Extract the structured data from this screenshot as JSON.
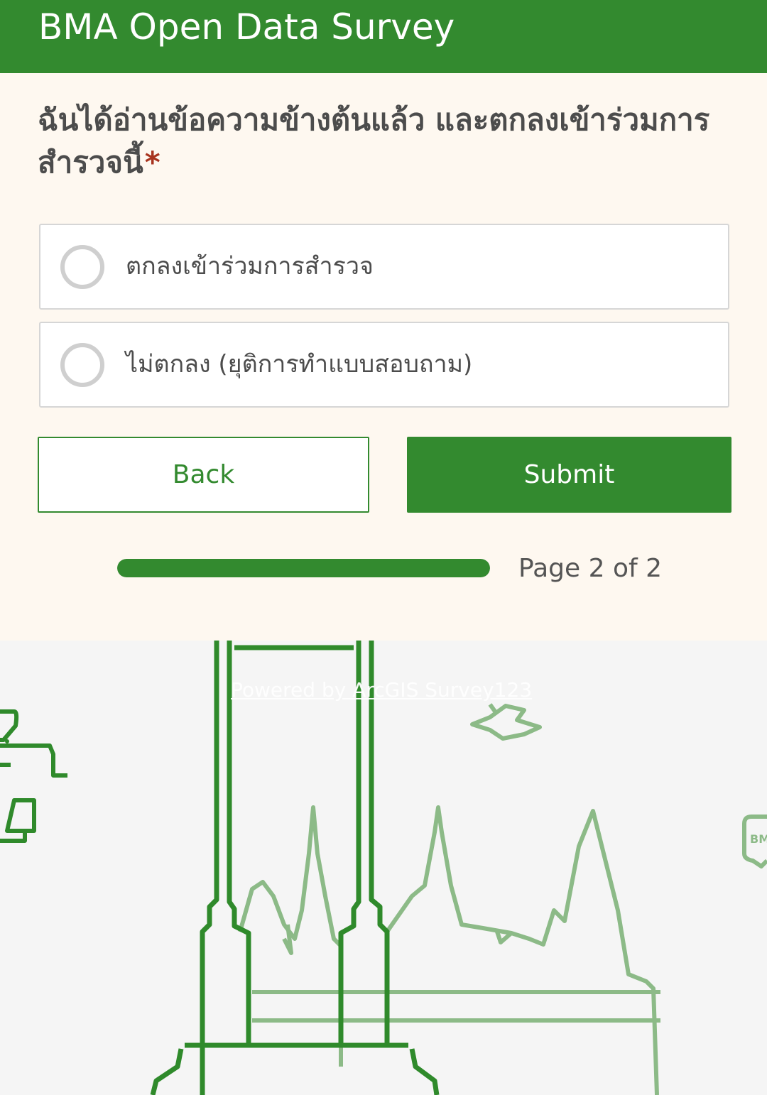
{
  "header": {
    "title": "BMA Open Data Survey"
  },
  "question": {
    "text": "ฉันได้อ่านข้อความข้างต้นแล้ว และตกลงเข้าร่วมการสำรวจนี้",
    "required_marker": "*"
  },
  "choices": [
    {
      "label": "ตกลงเข้าร่วมการสำรวจ",
      "selected": false
    },
    {
      "label": "ไม่ตกลง (ยุติการทำแบบสอบถาม)",
      "selected": false
    }
  ],
  "buttons": {
    "back_label": "Back",
    "submit_label": "Submit"
  },
  "progress": {
    "label": "Page 2 of 2",
    "fraction": 1.0
  },
  "footer": {
    "powered_by": "Powered by ArcGIS Survey123",
    "speech_badge_text": "BM"
  },
  "colors": {
    "brand_green": "#338a2f",
    "form_background": "#fef8f0",
    "required_red": "#a8341f",
    "illustration_light_green": "#8cba87"
  },
  "icons": {
    "radio": "radio-unchecked-icon",
    "illustration": "bangkok-giant-swing-and-temples-illustration"
  }
}
